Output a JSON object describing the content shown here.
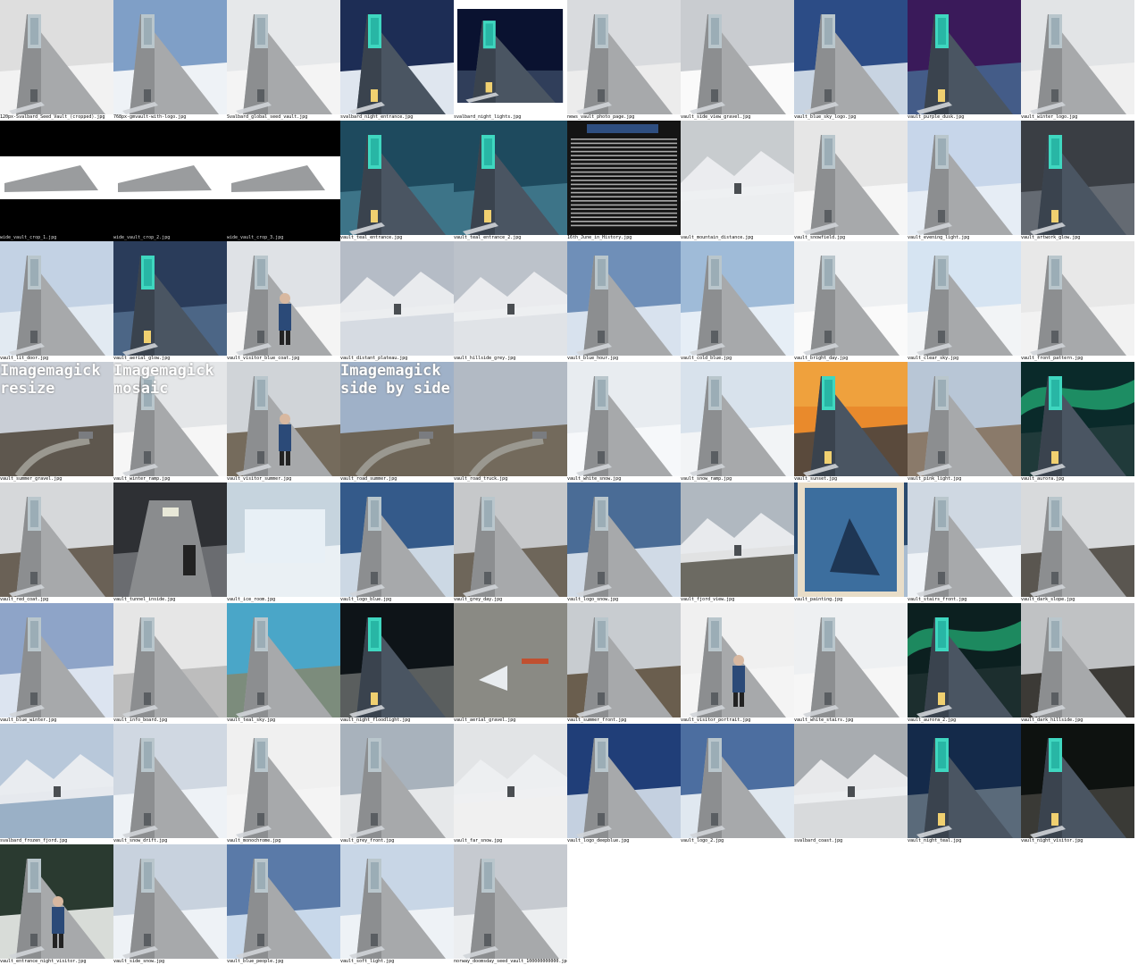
{
  "thumbnails": [
    {
      "caption": "120px-Svalbard_Seed_Vault_(cropped).jpg",
      "sky": "#dedede",
      "snow": "#f2f2f2",
      "scene": "vault",
      "frame": "none"
    },
    {
      "caption": "768px-gmvault-with-logo.jpg",
      "sky": "#7f9fc7",
      "snow": "#eef2f6",
      "scene": "vault",
      "frame": "none"
    },
    {
      "caption": "Svalbard_global_seed_vault.jpg",
      "sky": "#e6e8ea",
      "snow": "#f4f4f4",
      "scene": "vault",
      "frame": "none"
    },
    {
      "caption": "svalbard_night_entrance.jpg",
      "sky": "#1d2d55",
      "snow": "#dfe6ef",
      "scene": "vault_night",
      "frame": "none"
    },
    {
      "caption": "svalbard_night_lights.jpg",
      "sky": "#0a1230",
      "snow": "#303e5a",
      "scene": "vault_night",
      "frame": "white"
    },
    {
      "caption": "news_vault_photo_page.jpg",
      "sky": "#d9dbde",
      "snow": "#ececec",
      "scene": "vault",
      "frame": "none"
    },
    {
      "caption": "vault_side_view_gravel.jpg",
      "sky": "#c9ccd0",
      "snow": "#fafafa",
      "scene": "vault",
      "frame": "none"
    },
    {
      "caption": "vault_blue_sky_logo.jpg",
      "sky": "#2c4c86",
      "snow": "#c8d4e2",
      "scene": "vault",
      "frame": "none"
    },
    {
      "caption": "vault_purple_dusk.jpg",
      "sky": "#3a1a5a",
      "snow": "#445c88",
      "scene": "vault_night",
      "frame": "none"
    },
    {
      "caption": "vault_winter_logo.jpg",
      "sky": "#e2e4e6",
      "snow": "#f0f0f0",
      "scene": "vault",
      "frame": "none"
    },
    {
      "caption": "wide_vault_crop_1.jpg",
      "sky": "#ffffff",
      "snow": "#f4f4f4",
      "scene": "wide",
      "frame": "black"
    },
    {
      "caption": "wide_vault_crop_2.jpg",
      "sky": "#ffffff",
      "snow": "#f4f4f4",
      "scene": "wide",
      "frame": "black"
    },
    {
      "caption": "wide_vault_crop_3.jpg",
      "sky": "#ffffff",
      "snow": "#f4f4f4",
      "scene": "wide",
      "frame": "black"
    },
    {
      "caption": "vault_teal_entrance.jpg",
      "sky": "#1e4a5e",
      "snow": "#3d7488",
      "scene": "vault_teal",
      "frame": "none"
    },
    {
      "caption": "vault_teal_entrance_2.jpg",
      "sky": "#1e4a5e",
      "snow": "#3d7488",
      "scene": "vault_teal",
      "frame": "none"
    },
    {
      "caption": "16th_June_in_History.jpg",
      "sky": "#141414",
      "snow": "#141414",
      "scene": "text",
      "frame": "none"
    },
    {
      "caption": "vault_mountain_distance.jpg",
      "sky": "#c8cccf",
      "snow": "#eceef0",
      "scene": "landscape",
      "frame": "none"
    },
    {
      "caption": "vault_snowfield.jpg",
      "sky": "#e6e6e6",
      "snow": "#f6f6f6",
      "scene": "vault",
      "frame": "none"
    },
    {
      "caption": "vault_evening_light.jpg",
      "sky": "#c7d6ea",
      "snow": "#e6edf5",
      "scene": "vault",
      "frame": "none"
    },
    {
      "caption": "vault_artwork_glow.jpg",
      "sky": "#3a3e44",
      "snow": "#646a72",
      "scene": "vault_night",
      "frame": "none"
    },
    {
      "caption": "vault_lit_door.jpg",
      "sky": "#c3d2e4",
      "snow": "#e2eaf2",
      "scene": "vault",
      "frame": "none"
    },
    {
      "caption": "vault_aerial_glow.jpg",
      "sky": "#2a3c5a",
      "snow": "#4c6686",
      "scene": "vault_night",
      "frame": "none"
    },
    {
      "caption": "vault_visitor_blue_coat.jpg",
      "sky": "#dfe2e6",
      "snow": "#f4f4f4",
      "scene": "person",
      "frame": "none"
    },
    {
      "caption": "vault_distant_plateau.jpg",
      "sky": "#b5bcc6",
      "snow": "#d6dbe2",
      "scene": "landscape",
      "frame": "none"
    },
    {
      "caption": "vault_hillside_grey.jpg",
      "sky": "#bcc2ca",
      "snow": "#e0e3e7",
      "scene": "landscape",
      "frame": "none"
    },
    {
      "caption": "vault_blue_hour.jpg",
      "sky": "#6f8fb8",
      "snow": "#d8e2ee",
      "scene": "vault",
      "frame": "none"
    },
    {
      "caption": "vault_cold_blue.jpg",
      "sky": "#9fbbd8",
      "snow": "#e6eef6",
      "scene": "vault",
      "frame": "none"
    },
    {
      "caption": "vault_bright_day.jpg",
      "sky": "#eef0f2",
      "snow": "#fafafa",
      "scene": "vault",
      "frame": "none"
    },
    {
      "caption": "vault_clear_sky.jpg",
      "sky": "#d6e4f2",
      "snow": "#f2f4f6",
      "scene": "vault",
      "frame": "none"
    },
    {
      "caption": "vault_front_pattern.jpg",
      "sky": "#e8e8e8",
      "snow": "#f2f2f2",
      "scene": "vault",
      "frame": "none"
    },
    {
      "caption": "vault_summer_gravel.jpg",
      "sky": "#c9ced6",
      "snow": "#5e574e",
      "scene": "summer",
      "frame": "none",
      "overlay": "Imagemagick\nresize"
    },
    {
      "caption": "vault_winter_ramp.jpg",
      "sky": "#e4e6e8",
      "snow": "#f6f6f6",
      "scene": "vault",
      "frame": "none",
      "overlay": "Imagemagick\nmosaic"
    },
    {
      "caption": "vault_visitor_summer.jpg",
      "sky": "#d0d4d8",
      "snow": "#756b5c",
      "scene": "person",
      "frame": "none"
    },
    {
      "caption": "vault_road_summer.jpg",
      "sky": "#9fb1c8",
      "snow": "#6d6456",
      "scene": "summer",
      "frame": "none",
      "overlay": "Imagemagick\nside by side"
    },
    {
      "caption": "vault_road_truck.jpg",
      "sky": "#b2bac4",
      "snow": "#736a5c",
      "scene": "summer",
      "frame": "none"
    },
    {
      "caption": "vault_white_snow.jpg",
      "sky": "#e8ecf0",
      "snow": "#f6f8fa",
      "scene": "vault",
      "frame": "none"
    },
    {
      "caption": "vault_snow_ramp.jpg",
      "sky": "#d8e2ec",
      "snow": "#f2f4f6",
      "scene": "vault",
      "frame": "none"
    },
    {
      "caption": "vault_sunset.jpg",
      "sky": "#e98a2c",
      "snow": "#5a4a3c",
      "scene": "vault_sunset",
      "frame": "none"
    },
    {
      "caption": "vault_pink_light.jpg",
      "sky": "#b8c6d6",
      "snow": "#8a7a6a",
      "scene": "vault",
      "frame": "none"
    },
    {
      "caption": "vault_aurora.jpg",
      "sky": "#0a2a2a",
      "snow": "#203a3a",
      "scene": "aurora",
      "frame": "none"
    },
    {
      "caption": "vault_red_coat.jpg",
      "sky": "#d6d8da",
      "snow": "#6a6156",
      "scene": "vault",
      "frame": "none"
    },
    {
      "caption": "vault_tunnel_inside.jpg",
      "sky": "#2e3034",
      "snow": "#6a6c70",
      "scene": "tunnel",
      "frame": "none"
    },
    {
      "caption": "vault_ice_room.jpg",
      "sky": "#c6d4de",
      "snow": "#eaf0f4",
      "scene": "ice",
      "frame": "none"
    },
    {
      "caption": "vault_logo_blue.jpg",
      "sky": "#345a8a",
      "snow": "#ccd8e4",
      "scene": "vault",
      "frame": "none"
    },
    {
      "caption": "vault_grey_day.jpg",
      "sky": "#c6c8ca",
      "snow": "#6e665a",
      "scene": "vault",
      "frame": "none"
    },
    {
      "caption": "vault_logo_snow.jpg",
      "sky": "#4a6c96",
      "snow": "#d0dae6",
      "scene": "vault",
      "frame": "none"
    },
    {
      "caption": "vault_fjord_view.jpg",
      "sky": "#b0b8c0",
      "snow": "#6c6a62",
      "scene": "landscape",
      "frame": "none"
    },
    {
      "caption": "vault_painting.jpg",
      "sky": "#2a4a6e",
      "snow": "#a8bcd0",
      "scene": "painting",
      "frame": "none"
    },
    {
      "caption": "vault_stairs_front.jpg",
      "sky": "#cfd8e2",
      "snow": "#eef2f6",
      "scene": "vault",
      "frame": "none"
    },
    {
      "caption": "vault_dark_slope.jpg",
      "sky": "#d8dadc",
      "snow": "#5a5650",
      "scene": "vault",
      "frame": "none"
    },
    {
      "caption": "vault_blue_winter.jpg",
      "sky": "#8ea4c8",
      "snow": "#dce4f0",
      "scene": "vault",
      "frame": "none"
    },
    {
      "caption": "vault_info_board.jpg",
      "sky": "#e6e6e6",
      "snow": "#bdbdbd",
      "scene": "vault",
      "frame": "none"
    },
    {
      "caption": "vault_teal_sky.jpg",
      "sky": "#4aa6c8",
      "snow": "#7c8c7c",
      "scene": "vault",
      "frame": "none"
    },
    {
      "caption": "vault_night_floodlight.jpg",
      "sky": "#0e1418",
      "snow": "#5a5e5e",
      "scene": "vault_night",
      "frame": "none"
    },
    {
      "caption": "vault_aerial_gravel.jpg",
      "sky": "#8a8a84",
      "snow": "#8a8a84",
      "scene": "aerial",
      "frame": "none"
    },
    {
      "caption": "vault_summer_front.jpg",
      "sky": "#c8ccd0",
      "snow": "#6a5e4e",
      "scene": "vault",
      "frame": "none"
    },
    {
      "caption": "vault_visitor_portrait.jpg",
      "sky": "#f0f0f0",
      "snow": "#f4f4f4",
      "scene": "person",
      "frame": "none"
    },
    {
      "caption": "vault_white_stairs.jpg",
      "sky": "#eef0f2",
      "snow": "#f6f6f6",
      "scene": "vault",
      "frame": "none"
    },
    {
      "caption": "vault_aurora_2.jpg",
      "sky": "#0c2020",
      "snow": "#1c2e2e",
      "scene": "aurora",
      "frame": "none"
    },
    {
      "caption": "vault_dark_hillside.jpg",
      "sky": "#c0c2c4",
      "snow": "#3c3a36",
      "scene": "vault",
      "frame": "none"
    },
    {
      "caption": "svalbard_frozen_fjord.jpg",
      "sky": "#b8c8da",
      "snow": "#9ab0c6",
      "scene": "landscape",
      "frame": "none"
    },
    {
      "caption": "vault_snow_drift.jpg",
      "sky": "#d0d8e2",
      "snow": "#eef2f6",
      "scene": "vault",
      "frame": "none"
    },
    {
      "caption": "vault_monochrome.jpg",
      "sky": "#f0f0f0",
      "snow": "#f4f4f4",
      "scene": "vault",
      "frame": "none"
    },
    {
      "caption": "vault_grey_front.jpg",
      "sky": "#a8b2bc",
      "snow": "#e6e8ea",
      "scene": "vault",
      "frame": "none"
    },
    {
      "caption": "vault_far_snow.jpg",
      "sky": "#e2e4e6",
      "snow": "#f0f0f0",
      "scene": "landscape",
      "frame": "none"
    },
    {
      "caption": "vault_logo_deepblue.jpg",
      "sky": "#203e78",
      "snow": "#c4d0e0",
      "scene": "vault",
      "frame": "none"
    },
    {
      "caption": "vault_logo_2.jpg",
      "sky": "#4c6ea0",
      "snow": "#e0e8f0",
      "scene": "vault",
      "frame": "none"
    },
    {
      "caption": "svalbard_coast.jpg",
      "sky": "#a8acb0",
      "snow": "#d8dadc",
      "scene": "landscape",
      "frame": "none"
    },
    {
      "caption": "vault_night_teal.jpg",
      "sky": "#142a4a",
      "snow": "#5a6a7a",
      "scene": "vault_night",
      "frame": "none"
    },
    {
      "caption": "vault_night_visitor.jpg",
      "sky": "#0e1210",
      "snow": "#3a3a36",
      "scene": "vault_night",
      "frame": "none"
    },
    {
      "caption": "vault_entrance_night_visitor.jpg",
      "sky": "#2a3a30",
      "snow": "#d8dcd8",
      "scene": "person",
      "frame": "none"
    },
    {
      "caption": "vault_side_snow.jpg",
      "sky": "#c8d2de",
      "snow": "#eef2f6",
      "scene": "vault",
      "frame": "none"
    },
    {
      "caption": "vault_blue_people.jpg",
      "sky": "#5a7aa8",
      "snow": "#c8d8ea",
      "scene": "vault",
      "frame": "none"
    },
    {
      "caption": "vault_soft_light.jpg",
      "sky": "#c8d6e6",
      "snow": "#eef2f6",
      "scene": "vault",
      "frame": "none"
    },
    {
      "caption": "norway_doomsday_seed_vault_100000000000.jpg",
      "sky": "#c6cad0",
      "snow": "#eceef0",
      "scene": "vault",
      "frame": "none"
    }
  ]
}
